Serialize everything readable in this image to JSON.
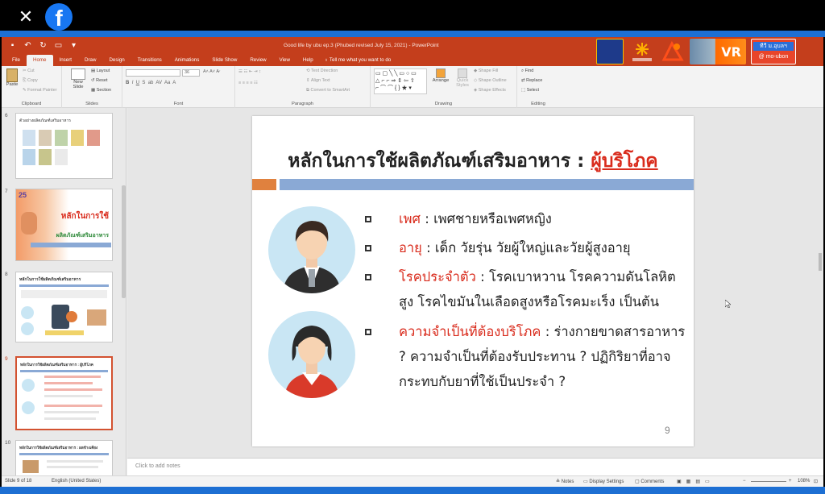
{
  "overlay": {
    "close_glyph": "✕",
    "fb_glyph": "f"
  },
  "window": {
    "title": "Good life by ubu ep.3 (Phubed revised July 15, 2021) - PowerPoint"
  },
  "tabs": [
    "File",
    "Home",
    "Insert",
    "Draw",
    "Design",
    "Transitions",
    "Animations",
    "Slide Show",
    "Review",
    "View",
    "Help"
  ],
  "tell_me": "Tell me what you want to do",
  "logos": [
    "Kasetsart",
    "อยู่ดีมีแฮง",
    "ubu",
    "VR",
    "ทีวี ม.อุบลฯ"
  ],
  "ribbon": {
    "clipboard": {
      "label": "Clipboard",
      "paste": "Paste",
      "cut": "Cut",
      "copy": "Copy",
      "format_painter": "Format Painter"
    },
    "slides": {
      "label": "Slides",
      "new_slide": "New Slide",
      "layout": "Layout",
      "reset": "Reset",
      "section": "Section"
    },
    "font": {
      "label": "Font",
      "size": "36"
    },
    "paragraph": {
      "label": "Paragraph",
      "text_direction": "Text Direction",
      "align_text": "Align Text",
      "smartart": "Convert to SmartArt"
    },
    "drawing": {
      "label": "Drawing",
      "arrange": "Arrange",
      "quick_styles": "Quick Styles",
      "shape_fill": "Shape Fill",
      "shape_outline": "Shape Outline",
      "shape_effects": "Shape Effects"
    },
    "editing": {
      "label": "Editing",
      "find": "Find",
      "replace": "Replace",
      "select": "Select"
    }
  },
  "thumbnails": [
    {
      "num": "6",
      "title": "ตัวอย่างผลิตภัณฑ์เสริมอาหาร"
    },
    {
      "num": "7",
      "title": "หลักในการใช้",
      "subtitle": "ผลิตภัณฑ์เสริมอาหาร"
    },
    {
      "num": "8",
      "title": "หลักในการใช้ผลิตภัณฑ์เสริมอาหาร"
    },
    {
      "num": "9",
      "title": "หลักในการใช้ผลิตภัณฑ์เสริมอาหาร : ผู้บริโภค"
    },
    {
      "num": "10",
      "title": "หลักในการใช้ผลิตภัณฑ์เสริมอาหาร : ผลข้างเคียง"
    }
  ],
  "slide": {
    "title_main": "หลักในการใช้ผลิตภัณฑ์เสริมอาหาร : ",
    "title_highlight": "ผู้บริโภค",
    "page_number": "9",
    "bullets": [
      {
        "key": "เพศ",
        "sep": "  :  ",
        "text": "เพศชายหรือเพศหญิง"
      },
      {
        "key": "อายุ",
        "sep": "  :  ",
        "text": "เด็ก วัยรุ่น  วัยผู้ใหญ่และวัยผู้สูงอายุ"
      },
      {
        "key": "โรคประจำตัว",
        "sep": " : ",
        "text": "โรคเบาหวาน โรคความดันโลหิตสูง  โรคไขมันในเลือดสูงหรือโรคมะเร็ง เป็นต้น"
      },
      {
        "key": "ความจำเป็นที่ต้องบริโภค",
        "sep": " : ",
        "text": "ร่างกายขาดสารอาหาร ? ความจำเป็นที่ต้องรับประทาน ? ปฏิกิริยาที่อาจกระทบกับยาที่ใช้เป็นประจำ ?"
      }
    ]
  },
  "notes_placeholder": "Click to add notes",
  "status": {
    "slide": "Slide 9 of 18",
    "language": "English (United States)",
    "notes": "Notes",
    "display_settings": "Display Settings",
    "comments": "Comments",
    "zoom": "108%"
  },
  "colors": {
    "ppt_red": "#c43e1c",
    "accent_red": "#d92b1c",
    "blue_bar": "#8aa9d5",
    "orange_block": "#e0813e"
  }
}
